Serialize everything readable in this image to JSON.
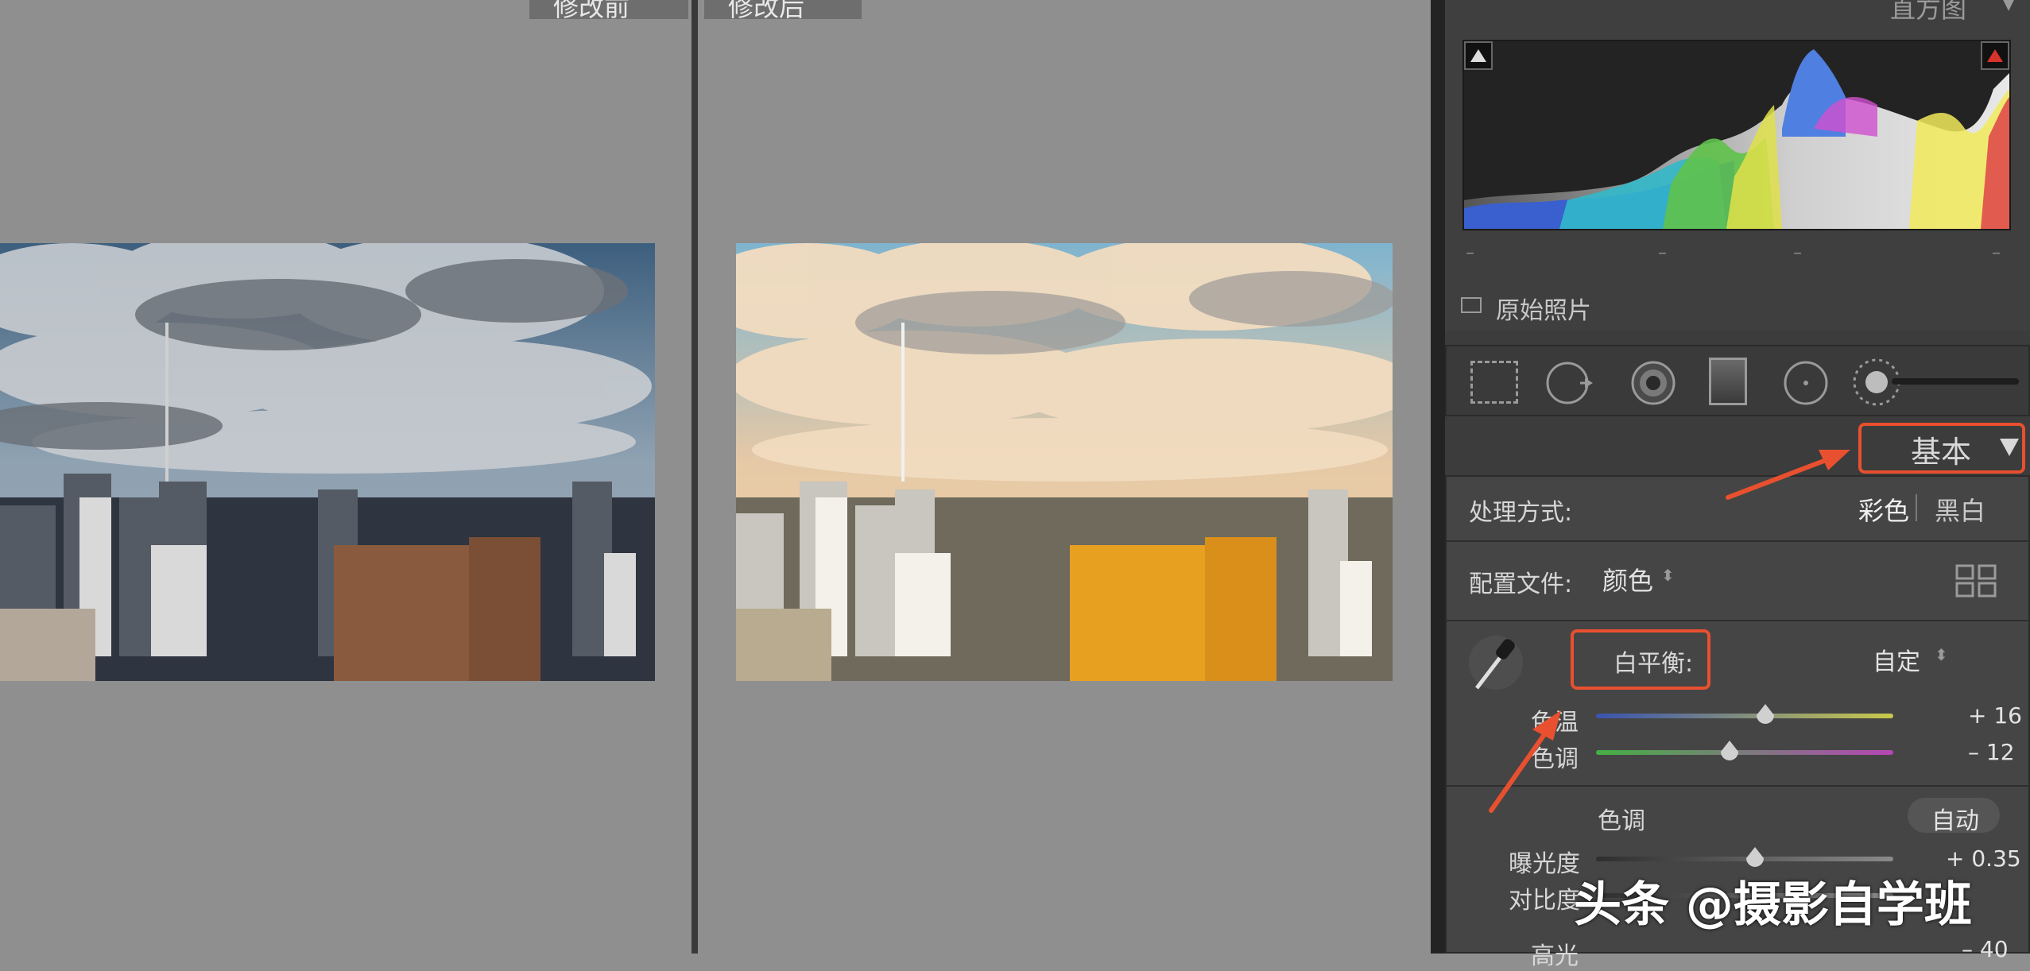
{
  "compare": {
    "before_label": "修改前",
    "after_label": "修改后"
  },
  "histogram": {
    "title": "直方图",
    "original_photo_label": "原始照片",
    "dash_marks": [
      "–",
      "–",
      "–",
      "–"
    ]
  },
  "tools": {
    "icons": [
      "crop-overlay-icon",
      "spot-removal-icon",
      "red-eye-icon",
      "graduated-filter-icon",
      "radial-filter-icon",
      "brush-icon"
    ]
  },
  "basic_panel": {
    "title": "基本",
    "treatment_label": "处理方式:",
    "treatment_color": "彩色",
    "treatment_bw": "黑白",
    "profile_label": "配置文件:",
    "profile_value": "颜色",
    "wb_label": "白平衡:",
    "wb_value": "自定",
    "temp_label": "色温",
    "temp_value": "+ 16",
    "tint_label": "色调",
    "tint_value": "– 12",
    "tone_label": "色调",
    "auto_label": "自动",
    "exposure_label": "曝光度",
    "exposure_value": "+ 0.35",
    "contrast_label": "对比度",
    "highlights_label": "高光",
    "highlights_value": "– 40"
  },
  "sliders": {
    "temp": 0.57,
    "tint": 0.45,
    "exposure": 0.535
  },
  "watermark": "头条 @摄影自学班",
  "colors": {
    "accent_red": "#e8502f",
    "panel_bg": "#3c3c3c",
    "section_bg": "#454545"
  }
}
